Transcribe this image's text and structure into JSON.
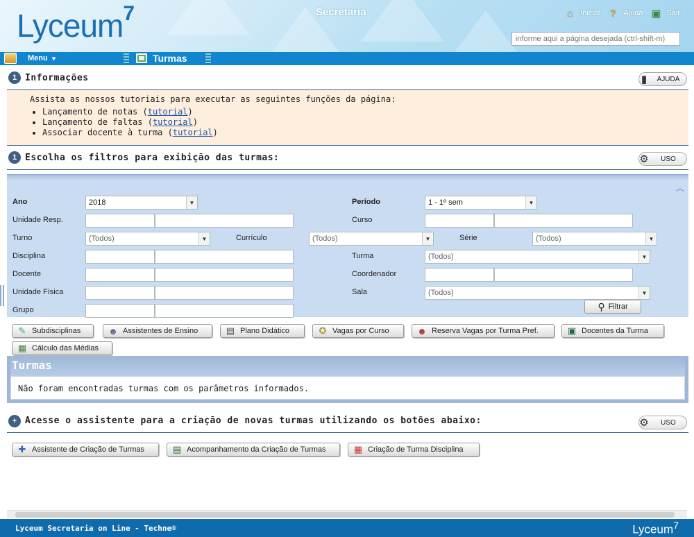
{
  "header": {
    "logo": "Lyceum",
    "logo_sup": "7",
    "module": "Secretaria",
    "links": [
      {
        "label": "Inicial",
        "icon": "home-icon"
      },
      {
        "label": "Ajuda",
        "icon": "help-icon"
      },
      {
        "label": "Sair",
        "icon": "exit-icon"
      }
    ],
    "search_placeholder": "informe aqui a página desejada (ctrl-shift-m)"
  },
  "navbar": {
    "menu_label": "Menu",
    "page_title": "Turmas"
  },
  "info": {
    "num": "1",
    "title": "Informações",
    "help_button": "AJUDA",
    "intro": "Assista as nossos tutoriais para executar as seguintes funções da página:",
    "items": [
      {
        "text": "Lançamento de notas (",
        "link": "tutorial",
        "end": ")"
      },
      {
        "text": "Lançamento de faltas (",
        "link": "tutorial",
        "end": ")"
      },
      {
        "text": "Associar docente à turma (",
        "link": "tutorial",
        "end": ")"
      }
    ]
  },
  "filters": {
    "num": "1",
    "title": "Escolha os filtros para exibição das turmas:",
    "uso_button": "USO",
    "ano_label": "Ano",
    "ano_value": "2018",
    "periodo_label": "Período",
    "periodo_value": "1 - 1º sem",
    "unidade_label": "Unidade Resp.",
    "curso_label": "Curso",
    "turno_label": "Turno",
    "turno_value": "(Todos)",
    "curriculo_label": "Currículo",
    "curriculo_value": "(Todos)",
    "serie_label": "Série",
    "serie_value": "(Todos)",
    "disciplina_label": "Disciplina",
    "turma_label": "Turma",
    "turma_value": "(Todos)",
    "docente_label": "Docente",
    "coordenador_label": "Coordenador",
    "unidade_fisica_label": "Unidade Física",
    "sala_label": "Sala",
    "sala_value": "(Todos)",
    "grupo_label": "Grupo",
    "filtrar_button": "Filtrar"
  },
  "actions": [
    {
      "label": "Subdisciplinas",
      "icon": "subdisciplinas-icon"
    },
    {
      "label": "Assistentes de Ensino",
      "icon": "users-icon"
    },
    {
      "label": "Plano Didático",
      "icon": "document-icon"
    },
    {
      "label": "Vagas por Curso",
      "icon": "vagas-icon"
    },
    {
      "label": "Reserva Vagas por Turma Pref.",
      "icon": "group-icon"
    },
    {
      "label": "Docentes da Turma",
      "icon": "teacher-icon"
    },
    {
      "label": "Cálculo das Médias",
      "icon": "calculator-icon"
    }
  ],
  "turmas": {
    "title": "Turmas",
    "empty_message": "Não foram encontradas turmas com os parâmetros informados."
  },
  "assistant": {
    "num": "+",
    "title": "Acesse o assistente para a criação de novas turmas utilizando os botões abaixo:",
    "uso_button": "USO",
    "buttons": [
      {
        "label": "Assistente de Criação de Turmas",
        "icon": "wizard-icon"
      },
      {
        "label": "Acompanhamento da Criação de Turmas",
        "icon": "report-icon"
      },
      {
        "label": "Criação de Turma Disciplina",
        "icon": "class-icon"
      }
    ]
  },
  "footer": {
    "text": "Lyceum Secretaria on Line - Techne®",
    "logo": "Lyceum",
    "logo_sup": "7"
  }
}
